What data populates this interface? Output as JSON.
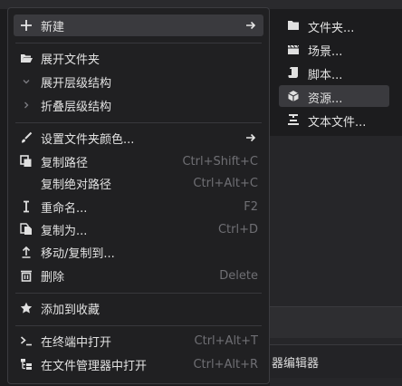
{
  "menu": {
    "new": "新建",
    "expand_folder": "展开文件夹",
    "expand_hierarchy": "展开层级结构",
    "collapse_hierarchy": "折叠层级结构",
    "set_folder_color": "设置文件夹颜色...",
    "copy_path": "复制路径",
    "copy_path_shortcut": "Ctrl+Shift+C",
    "copy_absolute_path": "复制绝对路径",
    "copy_absolute_path_shortcut": "Ctrl+Alt+C",
    "rename": "重命名...",
    "rename_shortcut": "F2",
    "duplicate": "复制为...",
    "duplicate_shortcut": "Ctrl+D",
    "move_copy": "移动/复制到...",
    "delete": "删除",
    "delete_shortcut": "Delete",
    "add_favorite": "添加到收藏",
    "open_terminal": "在终端中打开",
    "open_terminal_shortcut": "Ctrl+Alt+T",
    "open_file_manager": "在文件管理器中打开",
    "open_file_manager_shortcut": "Ctrl+Alt+R"
  },
  "submenu": {
    "folder": "文件夹...",
    "scene": "场景...",
    "script": "脚本...",
    "resource": "资源...",
    "text_file": "文本文件..."
  },
  "background": {
    "panel_label": "器编辑器"
  },
  "colors": {
    "menu_bg": "#202022",
    "highlight": "#3a3a3e",
    "shortcut": "#6f6f74"
  }
}
